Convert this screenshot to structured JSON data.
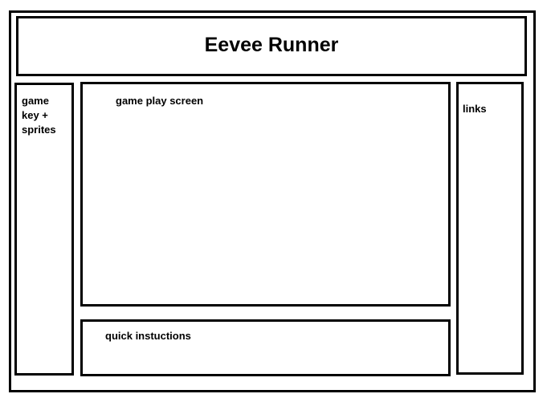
{
  "title": "Eevee Runner",
  "sidebar_left": {
    "lines": [
      "game",
      "key +",
      "sprites"
    ]
  },
  "game_screen": {
    "label": "game play screen"
  },
  "instructions": {
    "label": "quick instuctions"
  },
  "sidebar_right": {
    "label": "links"
  },
  "colors": {
    "stroke": "#000000",
    "background": "#ffffff"
  }
}
